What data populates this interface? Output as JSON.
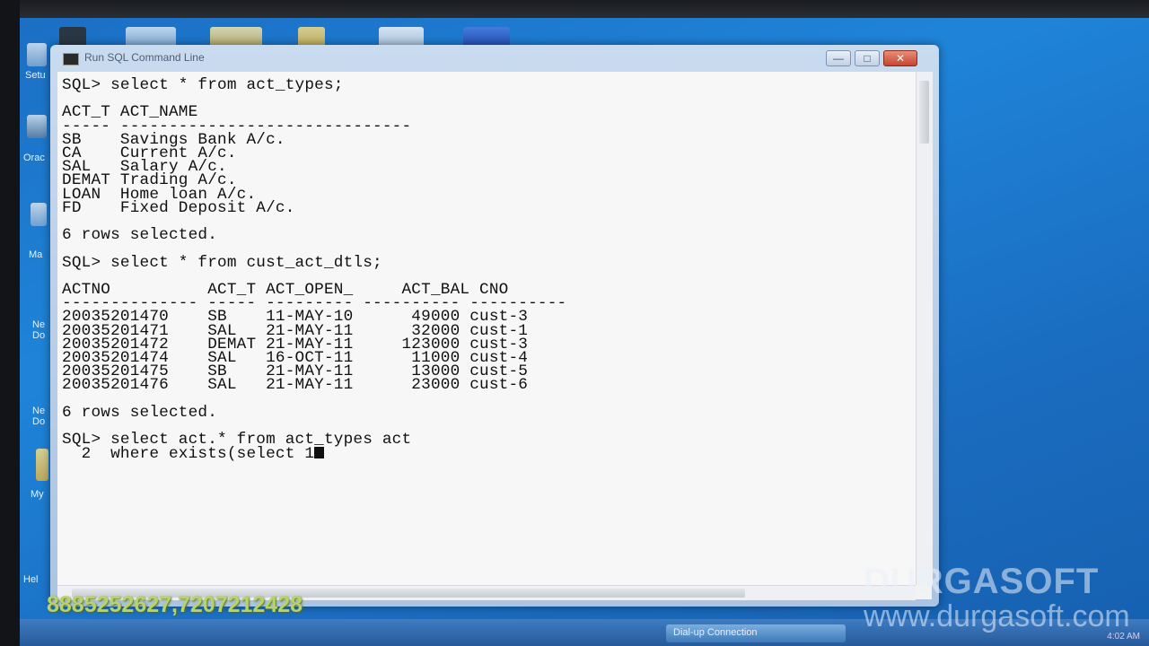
{
  "window": {
    "title": "Run SQL Command Line",
    "minimize": "—",
    "maximize": "□",
    "close": "✕"
  },
  "console": {
    "lines": [
      "SQL> select * from act_types;",
      "",
      "ACT_T ACT_NAME",
      "----- ------------------------------",
      "SB    Savings Bank A/c.",
      "CA    Current A/c.",
      "SAL   Salary A/c.",
      "DEMAT Trading A/c.",
      "LOAN  Home loan A/c.",
      "FD    Fixed Deposit A/c.",
      "",
      "6 rows selected.",
      "",
      "SQL> select * from cust_act_dtls;",
      "",
      "ACTNO          ACT_T ACT_OPEN_     ACT_BAL CNO",
      "-------------- ----- --------- ---------- ----------",
      "20035201470    SB    11-MAY-10      49000 cust-3",
      "20035201471    SAL   21-MAY-11      32000 cust-1",
      "20035201472    DEMAT 21-MAY-11     123000 cust-3",
      "20035201474    SAL   16-OCT-11      11000 cust-4",
      "20035201475    SB    21-MAY-11      13000 cust-5",
      "20035201476    SAL   21-MAY-11      23000 cust-6",
      "",
      "6 rows selected.",
      "",
      "SQL> select act.* from act_types act",
      "  2  where exists(select 1"
    ]
  },
  "watermark": {
    "phones": "8885252627,7207212428",
    "brand": "DURGASOFT",
    "url": "www.durgasoft.com"
  },
  "desktop": {
    "labels": [
      "Setu",
      "Orac",
      "Ma",
      "Ne Do",
      "Ne Do",
      "My",
      "Hel"
    ]
  },
  "taskbar": {
    "dialup": "Dial-up Connection",
    "clock": "4:02 AM"
  }
}
